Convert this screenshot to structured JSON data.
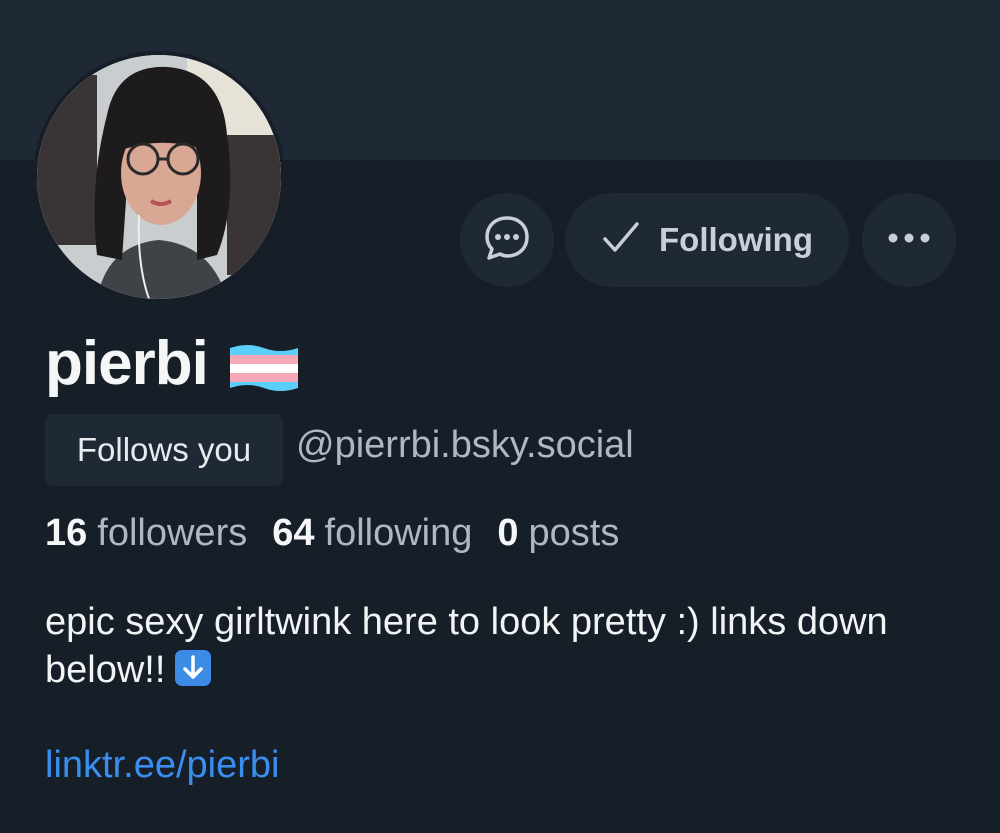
{
  "profile": {
    "display_name": "pierbi",
    "handle": "@pierrbi.bsky.social",
    "follows_you_label": "Follows you",
    "stats": {
      "followers_count": "16",
      "followers_label": "followers",
      "following_count": "64",
      "following_label": "following",
      "posts_count": "0",
      "posts_label": "posts"
    },
    "bio": "epic sexy girltwink here to look pretty :) links down below!!",
    "link": "linktr.ee/pierbi"
  },
  "actions": {
    "following_label": "Following",
    "message_icon": "chat-bubble-icon",
    "following_icon": "checkmark-icon",
    "more_icon": "ellipsis-icon"
  },
  "colors": {
    "background": "#161e27",
    "banner": "#1e2935",
    "button_bg": "#1e2935",
    "link": "#3a8ef0",
    "muted_text": "#aeb8c3",
    "flag_blue": "#5bcefa",
    "flag_pink": "#f5a9b8",
    "flag_white": "#ffffff"
  }
}
